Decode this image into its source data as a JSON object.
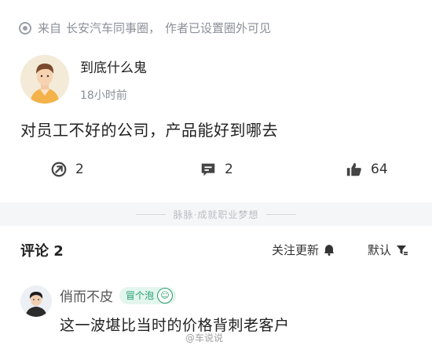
{
  "source": {
    "prefix": "来自",
    "circle": "长安汽车同事圈，",
    "visibility": "作者已设置圈外可见"
  },
  "post": {
    "author": "到底什么鬼",
    "time": "18小时前",
    "content": "对员工不好的公司，产品能好到哪去"
  },
  "actions": {
    "forward_count": "2",
    "comment_count": "2",
    "like_count": "64"
  },
  "divider_text": "脉脉·成就职业梦想",
  "comments_section": {
    "title": "评论 2",
    "follow_label": "关注更新",
    "sort_label": "默认"
  },
  "comments": [
    {
      "author": "俏而不皮",
      "badge": "冒个泡",
      "text": "这一波堪比当时的价格背刺老客户"
    }
  ],
  "watermark": "@车说说"
}
